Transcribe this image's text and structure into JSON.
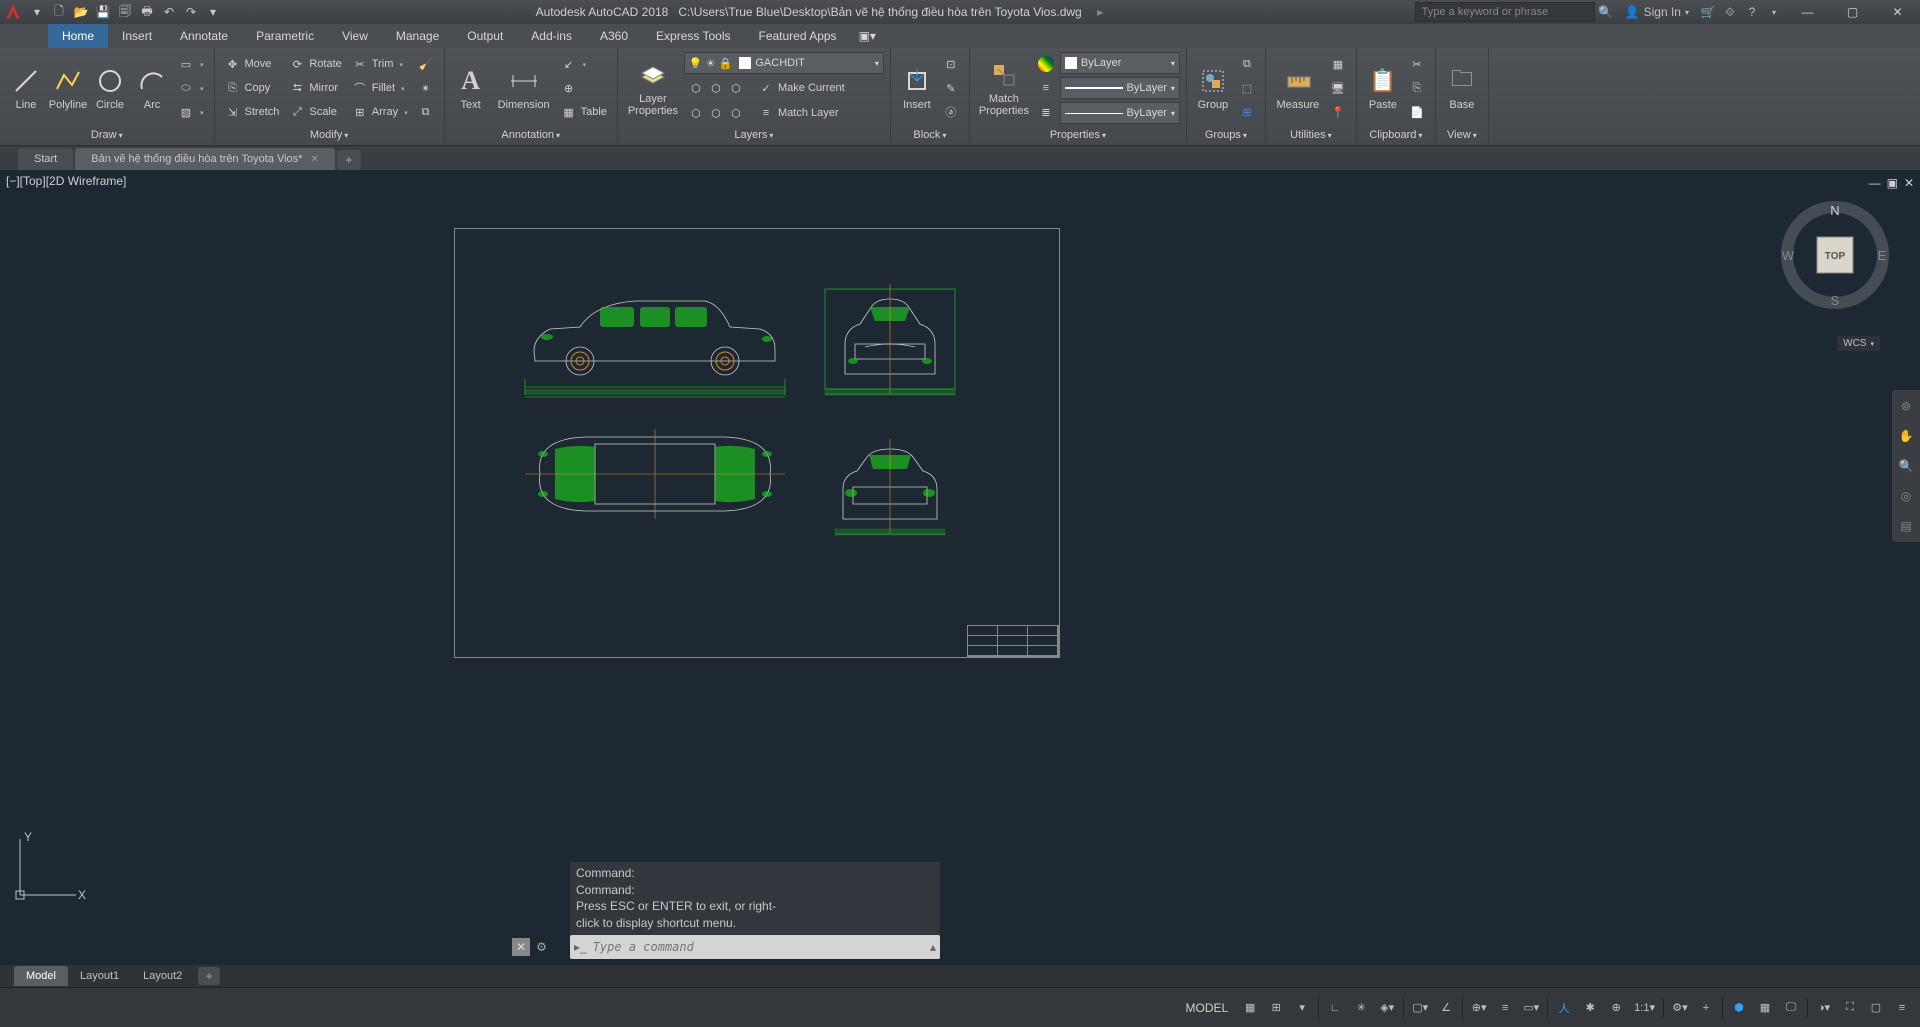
{
  "title": {
    "app": "Autodesk AutoCAD 2018",
    "path": "C:\\Users\\True Blue\\Desktop\\Bản vẽ hệ thống điều hòa trên Toyota Vios.dwg"
  },
  "search": {
    "placeholder": "Type a keyword or phrase"
  },
  "signin": "Sign In",
  "ribbon_tabs": [
    "Home",
    "Insert",
    "Annotate",
    "Parametric",
    "View",
    "Manage",
    "Output",
    "Add-ins",
    "A360",
    "Express Tools",
    "Featured Apps"
  ],
  "active_tab": "Home",
  "panels": {
    "draw": {
      "label": "Draw",
      "line": "Line",
      "polyline": "Polyline",
      "circle": "Circle",
      "arc": "Arc"
    },
    "modify": {
      "label": "Modify",
      "move": "Move",
      "copy": "Copy",
      "stretch": "Stretch",
      "rotate": "Rotate",
      "mirror": "Mirror",
      "scale": "Scale",
      "trim": "Trim",
      "fillet": "Fillet",
      "array": "Array"
    },
    "annotation": {
      "label": "Annotation",
      "text": "Text",
      "dimension": "Dimension",
      "table": "Table"
    },
    "layers": {
      "label": "Layers",
      "props": "Layer\nProperties",
      "current": "GACHDIT",
      "make_current": "Make Current",
      "match": "Match Layer"
    },
    "block": {
      "label": "Block",
      "insert": "Insert"
    },
    "properties": {
      "label": "Properties",
      "match": "Match\nProperties",
      "layer": "ByLayer"
    },
    "groups": {
      "label": "Groups",
      "group": "Group"
    },
    "utilities": {
      "label": "Utilities",
      "measure": "Measure"
    },
    "clipboard": {
      "label": "Clipboard",
      "paste": "Paste"
    },
    "view": {
      "label": "View",
      "base": "Base"
    }
  },
  "file_tabs": [
    {
      "label": "Start"
    },
    {
      "label": "Bản vẽ hệ thống điều hòa trên Toyota Vios*"
    }
  ],
  "viewport_label": "[−][Top][2D Wireframe]",
  "viewcube": {
    "face": "TOP",
    "n": "N",
    "s": "S",
    "e": "E",
    "w": "W",
    "wcs": "WCS"
  },
  "ucs": {
    "x": "X",
    "y": "Y"
  },
  "cmd_history": [
    "Command:",
    "Command:",
    "Press ESC or ENTER to exit, or right-",
    "click to display shortcut menu."
  ],
  "cmd_placeholder": "Type a command",
  "layout_tabs": [
    "Model",
    "Layout1",
    "Layout2"
  ],
  "active_layout": "Model",
  "status": {
    "model": "MODEL",
    "scale": "1:1"
  }
}
